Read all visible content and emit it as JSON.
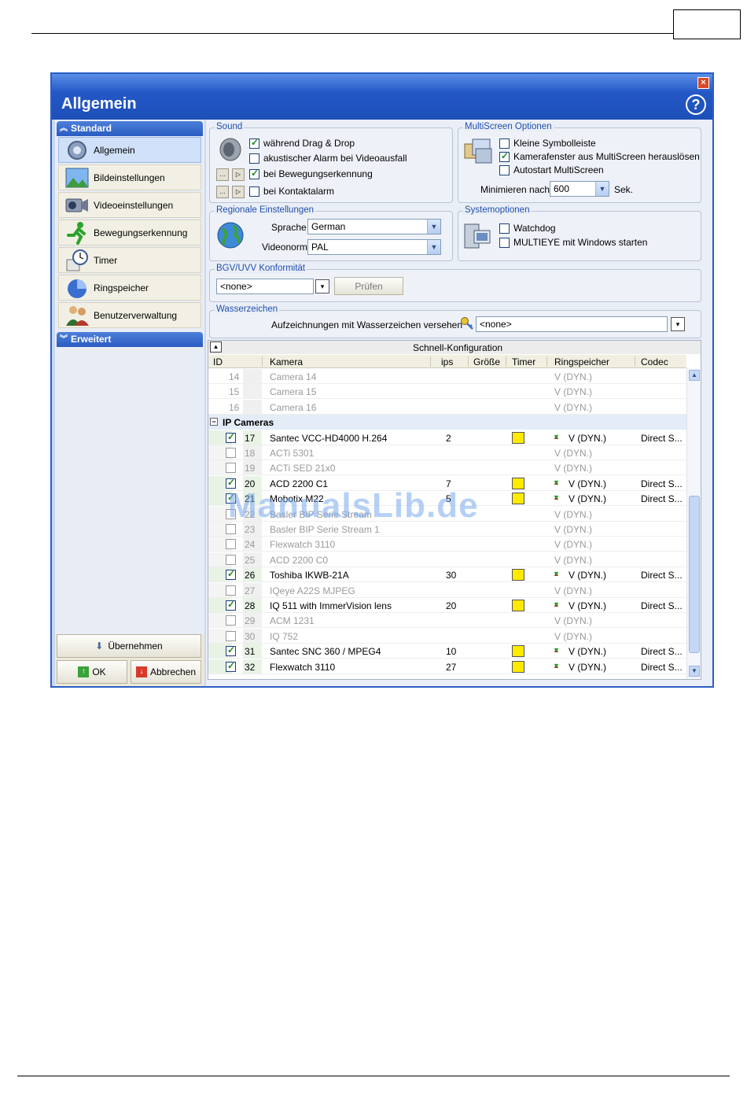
{
  "window": {
    "title": "Allgemein",
    "close_glyph": "×",
    "help_glyph": "?"
  },
  "sidebar": {
    "standard_header": "Standard",
    "items": [
      {
        "label": "Allgemein",
        "icon": "gears-icon"
      },
      {
        "label": "Bildeinstellungen",
        "icon": "landscape-icon"
      },
      {
        "label": "Videoeinstellungen",
        "icon": "camcorder-icon"
      },
      {
        "label": "Bewegungserkennung",
        "icon": "running-man-icon"
      },
      {
        "label": "Timer",
        "icon": "clock-icon"
      },
      {
        "label": "Ringspeicher",
        "icon": "pie-icon"
      },
      {
        "label": "Benutzerverwaltung",
        "icon": "users-icon"
      }
    ],
    "extended_header": "Erweitert",
    "apply_label": "Übernehmen",
    "ok_label": "OK",
    "cancel_label": "Abbrechen"
  },
  "sound": {
    "legend": "Sound",
    "options": [
      {
        "label": "während Drag & Drop",
        "checked": true
      },
      {
        "label": "akustischer Alarm bei Videoausfall",
        "checked": false
      },
      {
        "label": "bei Bewegungserkennung",
        "checked": true
      },
      {
        "label": "bei Kontaktalarm",
        "checked": false
      }
    ]
  },
  "multiscreen": {
    "legend": "MultiScreen Optionen",
    "options": [
      {
        "label": "Kleine Symbolleiste",
        "checked": false
      },
      {
        "label": "Kamerafenster aus MultiScreen herauslösen",
        "checked": true
      },
      {
        "label": "Autostart MultiScreen",
        "checked": false
      }
    ],
    "minimize_label": "Minimieren nach",
    "minimize_value": "600",
    "minimize_unit": "Sek."
  },
  "regional": {
    "legend": "Regionale Einstellungen",
    "language_label": "Sprache",
    "language_value": "German",
    "videonorm_label": "Videonorm",
    "videonorm_value": "PAL"
  },
  "system": {
    "legend": "Systemoptionen",
    "options": [
      {
        "label": "Watchdog",
        "checked": false
      },
      {
        "label": "MULTIEYE mit Windows starten",
        "checked": false
      }
    ]
  },
  "bgv": {
    "legend": "BGV/UVV Konformität",
    "value": "<none>",
    "check_label": "Prüfen"
  },
  "watermark": {
    "legend": "Wasserzeichen",
    "label": "Aufzeichnungen mit Wasserzeichen versehen",
    "value": "<none>"
  },
  "grid": {
    "caption": "Schnell-Konfiguration",
    "columns": [
      "ID",
      "Kamera",
      "ips",
      "Größe",
      "Timer",
      "Ringspeicher",
      "Codec"
    ],
    "top_rows": [
      {
        "id": "14",
        "camera": "Camera 14",
        "ring": "V (DYN.)"
      },
      {
        "id": "15",
        "camera": "Camera 15",
        "ring": "V (DYN.)"
      },
      {
        "id": "16",
        "camera": "Camera 16",
        "ring": "V (DYN.)"
      }
    ],
    "group_label": "IP Cameras",
    "rows": [
      {
        "id": "17",
        "checked": true,
        "camera": "Santec VCC-HD4000 H.264",
        "ips": "2",
        "timer": true,
        "ring": "V (DYN.)",
        "codec": "Direct S..."
      },
      {
        "id": "18",
        "checked": false,
        "camera": "ACTi 5301",
        "ips": "",
        "timer": false,
        "ring": "V (DYN.)",
        "codec": ""
      },
      {
        "id": "19",
        "checked": false,
        "camera": "ACTi SED 21x0",
        "ips": "",
        "timer": false,
        "ring": "V (DYN.)",
        "codec": ""
      },
      {
        "id": "20",
        "checked": true,
        "camera": "ACD 2200 C1",
        "ips": "7",
        "timer": true,
        "ring": "V (DYN.)",
        "codec": "Direct S..."
      },
      {
        "id": "21",
        "checked": true,
        "camera": "Mobotix M22",
        "ips": "5",
        "timer": true,
        "ring": "V (DYN.)",
        "codec": "Direct S..."
      },
      {
        "id": "22",
        "checked": false,
        "camera": "Basler BIP Serie Stream",
        "ips": "",
        "timer": false,
        "ring": "V (DYN.)",
        "codec": ""
      },
      {
        "id": "23",
        "checked": false,
        "camera": "Basler BIP Serie Stream 1",
        "ips": "",
        "timer": false,
        "ring": "V (DYN.)",
        "codec": ""
      },
      {
        "id": "24",
        "checked": false,
        "camera": "Flexwatch 3110",
        "ips": "",
        "timer": false,
        "ring": "V (DYN.)",
        "codec": ""
      },
      {
        "id": "25",
        "checked": false,
        "camera": "ACD 2200 C0",
        "ips": "",
        "timer": false,
        "ring": "V (DYN.)",
        "codec": ""
      },
      {
        "id": "26",
        "checked": true,
        "camera": "Toshiba IKWB-21A",
        "ips": "30",
        "timer": true,
        "ring": "V (DYN.)",
        "codec": "Direct S..."
      },
      {
        "id": "27",
        "checked": false,
        "camera": "IQeye A22S MJPEG",
        "ips": "",
        "timer": false,
        "ring": "V (DYN.)",
        "codec": ""
      },
      {
        "id": "28",
        "checked": true,
        "camera": "IQ 511 with ImmerVision lens",
        "ips": "20",
        "timer": true,
        "ring": "V (DYN.)",
        "codec": "Direct S..."
      },
      {
        "id": "29",
        "checked": false,
        "camera": "ACM 1231",
        "ips": "",
        "timer": false,
        "ring": "V (DYN.)",
        "codec": ""
      },
      {
        "id": "30",
        "checked": false,
        "camera": "IQ 752",
        "ips": "",
        "timer": false,
        "ring": "V (DYN.)",
        "codec": ""
      },
      {
        "id": "31",
        "checked": true,
        "camera": "Santec SNC 360 / MPEG4",
        "ips": "10",
        "timer": true,
        "ring": "V (DYN.)",
        "codec": "Direct S..."
      },
      {
        "id": "32",
        "checked": true,
        "camera": "Flexwatch 3110",
        "ips": "27",
        "timer": true,
        "ring": "V (DYN.)",
        "codec": "Direct S..."
      }
    ]
  },
  "watermark_overlay": "ManualsLib.de",
  "colors": {
    "accent": "#2458c6",
    "timer_yellow": "#ffea00",
    "group_legend": "#1f4fae"
  }
}
